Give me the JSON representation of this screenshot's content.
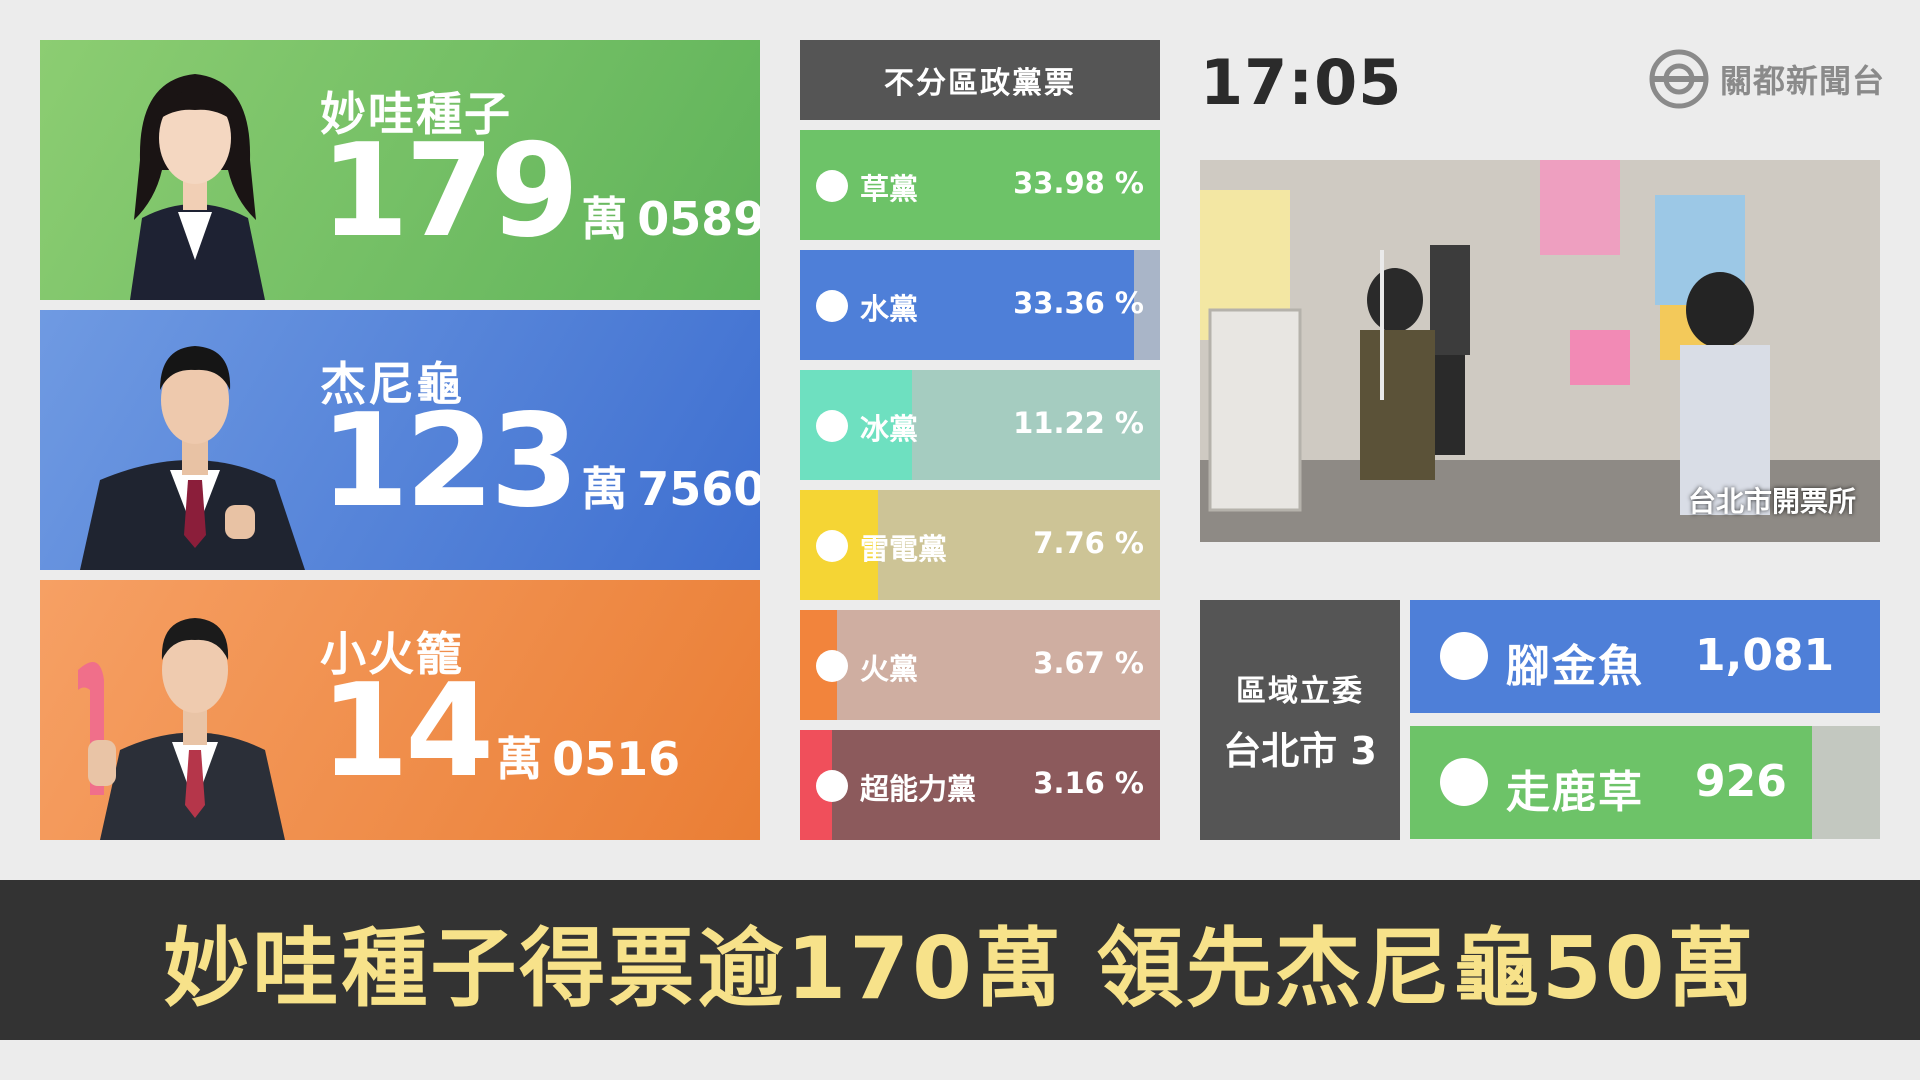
{
  "candidates": [
    {
      "name": "妙哇種子",
      "votes_big": "179",
      "unit": "萬",
      "votes_small": "0589",
      "color_from": "#5fb35a",
      "color_to": "#8ccd72"
    },
    {
      "name": "杰尼龜",
      "votes_big": "123",
      "unit": "萬",
      "votes_small": "7560",
      "color_from": "#3e6fd0",
      "color_to": "#6f9ae2"
    },
    {
      "name": "小火籠",
      "votes_big": "14",
      "unit": "萬",
      "votes_small": "0516",
      "color_from": "#ea7e35",
      "color_to": "#f6a064"
    }
  ],
  "party": {
    "title": "不分區政黨票",
    "items": [
      {
        "name": "草黨",
        "pct": "33.98 %",
        "share": 33.98,
        "color": "#6dc368",
        "bg": "#6dc368"
      },
      {
        "name": "水黨",
        "pct": "33.36 %",
        "share": 33.36,
        "color": "#4e7fd8",
        "bg": "#a9b5c8"
      },
      {
        "name": "冰黨",
        "pct": "11.22 %",
        "share": 11.22,
        "color": "#6ee0c0",
        "bg": "#a5ccc0"
      },
      {
        "name": "雷電黨",
        "pct": "7.76 %",
        "share": 7.76,
        "color": "#f5d534",
        "bg": "#cdc496"
      },
      {
        "name": "火黨",
        "pct": "3.67 %",
        "share": 3.67,
        "color": "#f2843c",
        "bg": "#cfaea1"
      },
      {
        "name": "超能力黨",
        "pct": "3.16 %",
        "share": 3.16,
        "color": "#f04f5b",
        "bg": "#8c5a5c"
      }
    ]
  },
  "clock": "17:05",
  "logo": {
    "text": "關都新聞台",
    "icon": "broadcast-logo-icon",
    "color": "#8a8a8a"
  },
  "scene": {
    "caption": "台北市開票所"
  },
  "district": {
    "line1": "區域立委",
    "line2": "台北市 3",
    "candidates": [
      {
        "name": "腳金魚",
        "votes": "1,081",
        "share": 1.0,
        "color": "#4e7fd8",
        "bg": "#4e7fd8"
      },
      {
        "name": "走鹿草",
        "votes": "926",
        "share": 0.856,
        "color": "#6dc368",
        "bg": "#c3c8c0"
      }
    ]
  },
  "ticker": "妙哇種子得票逾170萬 領先杰尼龜50萬"
}
